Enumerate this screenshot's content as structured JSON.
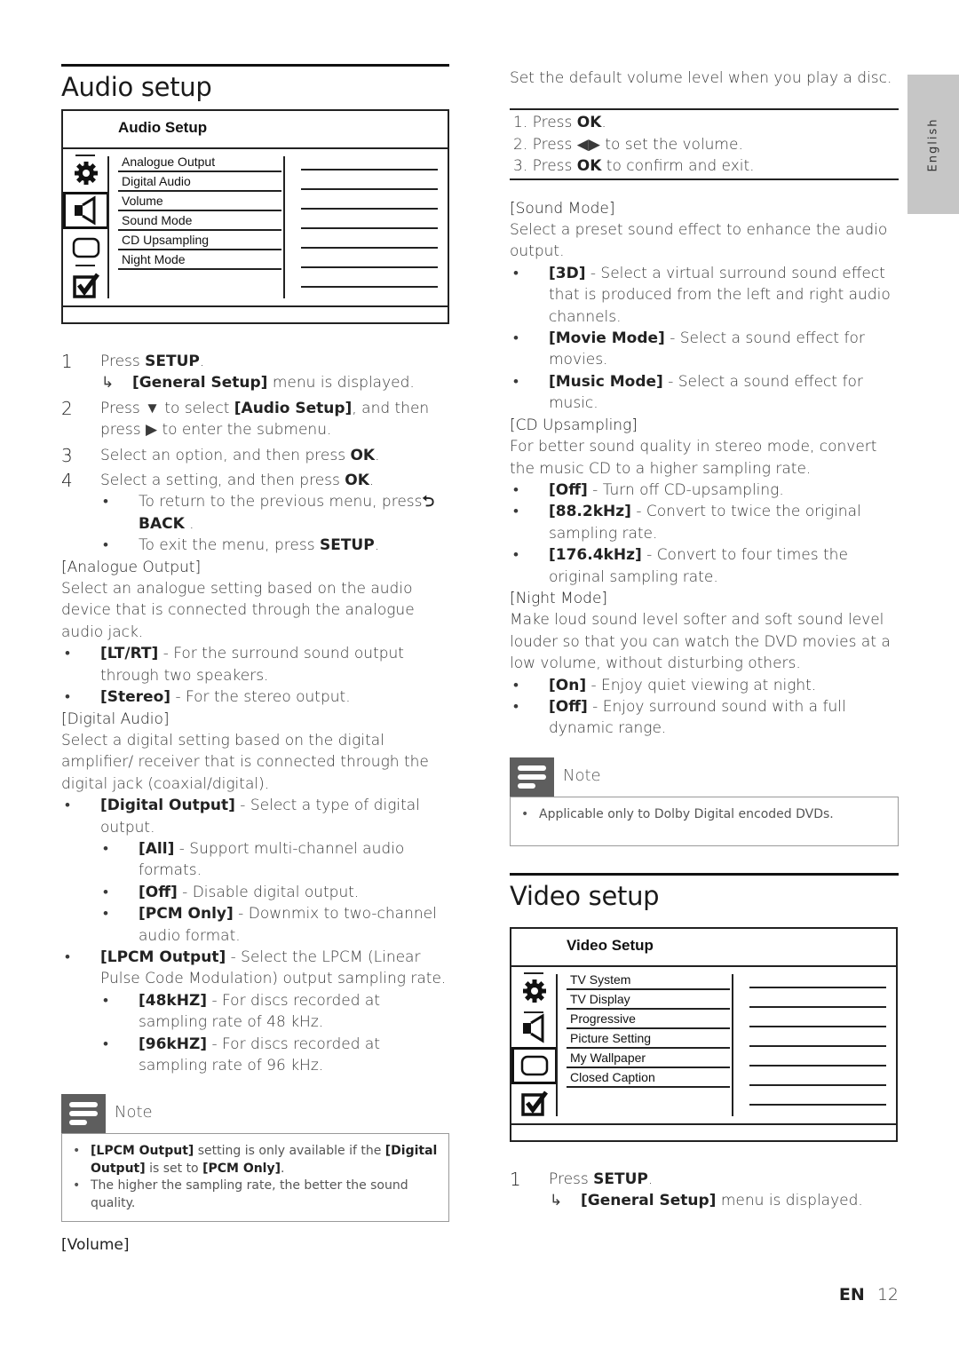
{
  "language_tab": "English",
  "audio": {
    "title": "Audio setup",
    "menu": {
      "header": "Audio Setup",
      "icons": [
        "gear-icon",
        "speaker-icon",
        "screen-icon",
        "checkbox-icon"
      ],
      "active_icon": "speaker-icon",
      "options": [
        "Analogue Output",
        "Digital Audio",
        "Volume",
        "Sound Mode",
        "CD Upsampling",
        "Night Mode"
      ]
    },
    "steps": [
      {
        "num": "1",
        "pre": "Press ",
        "bold": "SETUP",
        "post": "."
      },
      {
        "num": "2",
        "line1_pre": "Press ▼ to select ",
        "line1_bold": "[Audio Setup]",
        "line1_post": ", and then",
        "line2": "press ▶ to enter the submenu."
      },
      {
        "num": "3",
        "pre": "Select an option, and then press ",
        "bold": "OK",
        "post": "."
      },
      {
        "num": "4",
        "pre": "Select a setting, and then press ",
        "bold": "OK",
        "post": "."
      }
    ],
    "step1_result": {
      "arrow": "↳",
      "bold": "[General Setup]",
      "post": " menu is displayed."
    },
    "step4_bullets": [
      {
        "pre": "To return to the previous menu, press",
        "icon": "⮌",
        "bold": "BACK",
        "post": " ."
      },
      {
        "pre": "To exit the menu, press ",
        "bold": "SETUP",
        "post": "."
      }
    ],
    "analogue": {
      "heading": "[Analogue Output]",
      "desc": "Select an analogue setting based on the audio device that is connected through the analogue audio jack.",
      "items": [
        {
          "bold": "[LT/RT]",
          "text": " - For the surround sound output through two speakers."
        },
        {
          "bold": "[Stereo]",
          "text": " - For the stereo output."
        }
      ]
    },
    "digital": {
      "heading": "[Digital Audio]",
      "desc": "Select a digital setting based on the digital amplifier/ receiver that is connected through the digital jack (coaxial/digital).",
      "digital_output": {
        "bold": "[Digital Output]",
        "text": " - Select a type of digital output."
      },
      "digital_output_items": [
        {
          "bold": "[All]",
          "text": " - Support multi-channel audio formats."
        },
        {
          "bold": "[Off]",
          "text": " - Disable digital output."
        },
        {
          "bold": "[PCM Only]",
          "text": " - Downmix to two-channel audio format."
        }
      ],
      "lpcm_output": {
        "bold": "[LPCM Output]",
        "text": " - Select the LPCM (Linear Pulse Code Modulation) output sampling rate."
      },
      "lpcm_items": [
        {
          "bold": "[48kHZ]",
          "text": " - For discs recorded at sampling rate of 48 kHz."
        },
        {
          "bold": "[96kHZ]",
          "text": " - For discs recorded at sampling rate of 96 kHz."
        }
      ]
    },
    "note": {
      "title": "Note",
      "items": [
        {
          "b1": "[LPCM Output]",
          "t1": " setting is only available if the ",
          "b2": "[Digital Output]",
          "t2": " is set to ",
          "b3": "[PCM Only]",
          "t3": "."
        },
        {
          "text": "The higher the sampling rate, the better the sound quality."
        }
      ]
    },
    "volume_heading": "[Volume]"
  },
  "right": {
    "volume_desc": "Set the default volume level when you play a disc.",
    "volume_steps": [
      {
        "pre": "1. Press ",
        "bold": "OK",
        "post": "."
      },
      {
        "pre": "2. Press ◀▶ to set the volume.",
        "bold": "",
        "post": ""
      },
      {
        "pre": "3. Press ",
        "bold": "OK",
        "post": " to confirm and exit."
      }
    ],
    "sound_mode": {
      "heading": "[Sound Mode]",
      "desc": "Select a preset sound effect to enhance the audio output.",
      "items": [
        {
          "bold": "[3D]",
          "text": " - Select a virtual surround sound effect that is produced from the left and right audio channels."
        },
        {
          "bold": "[Movie Mode]",
          "text": " - Select a sound effect for movies."
        },
        {
          "bold": "[Music Mode]",
          "text": " - Select a sound effect for music."
        }
      ]
    },
    "cd_upsampling": {
      "heading": "[CD Upsampling]",
      "desc": "For better sound quality in stereo mode, convert the music CD to a higher sampling rate.",
      "items": [
        {
          "bold": "[Off]",
          "text": " - Turn off CD-upsampling."
        },
        {
          "bold": "[88.2kHz]",
          "text": " - Convert to twice the original sampling rate."
        },
        {
          "bold": "[176.4kHz]",
          "text": " - Convert to four times the original sampling rate."
        }
      ]
    },
    "night_mode": {
      "heading": "[Night Mode]",
      "desc": "Make loud sound level softer and soft sound level louder so that you can watch the DVD movies at a low volume, without disturbing others.",
      "items": [
        {
          "bold": "[On]",
          "text": " - Enjoy quiet viewing at night."
        },
        {
          "bold": "[Off]",
          "text": " - Enjoy surround sound with a full dynamic range."
        }
      ]
    },
    "note": {
      "title": "Note",
      "items": [
        "Applicable only to Dolby Digital encoded DVDs."
      ]
    }
  },
  "video": {
    "title": "Video setup",
    "menu": {
      "header": "Video Setup",
      "icons": [
        "gear-icon",
        "speaker-icon",
        "screen-icon",
        "checkbox-icon"
      ],
      "active_icon": "screen-icon",
      "options": [
        "TV System",
        "TV Display",
        "Progressive",
        "Picture Setting",
        "My Wallpaper",
        "Closed Caption"
      ]
    },
    "step1": {
      "num": "1",
      "pre": "Press ",
      "bold": "SETUP",
      "post": "."
    },
    "step1_result": {
      "arrow": "↳",
      "bold": "[General Setup]",
      "post": " menu is displayed."
    }
  },
  "footer": {
    "lang": "EN",
    "page": "12"
  }
}
